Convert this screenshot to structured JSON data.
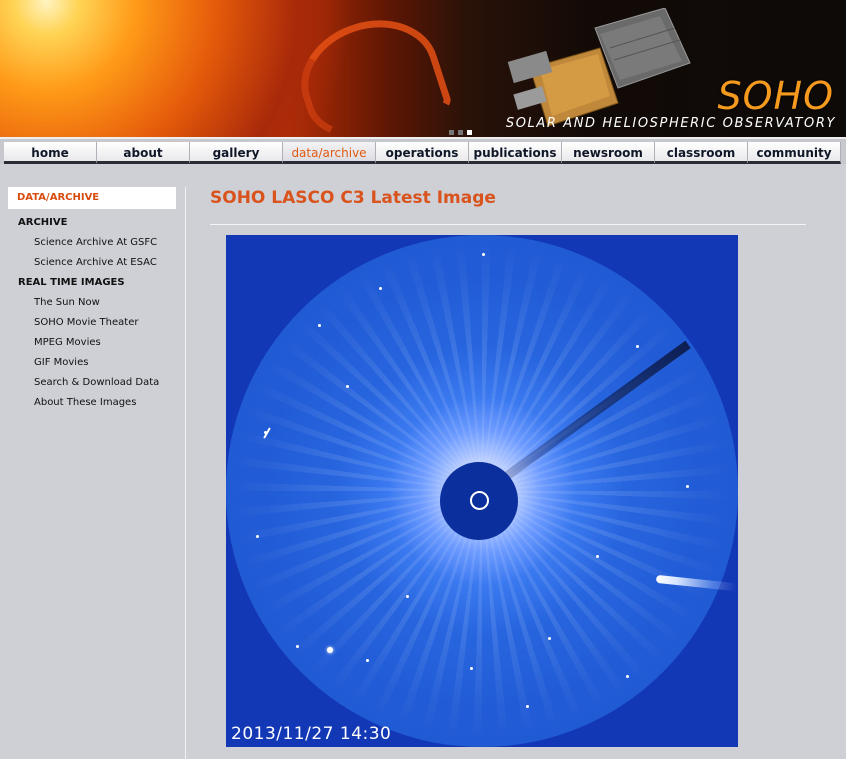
{
  "header": {
    "logo": "SOHO",
    "tagline": "SOLAR AND HELIOSPHERIC OBSERVATORY"
  },
  "nav": {
    "items": [
      {
        "label": "home"
      },
      {
        "label": "about"
      },
      {
        "label": "gallery"
      },
      {
        "label": "data/archive",
        "active": true
      },
      {
        "label": "operations"
      },
      {
        "label": "publications"
      },
      {
        "label": "newsroom"
      },
      {
        "label": "classroom"
      },
      {
        "label": "community"
      }
    ]
  },
  "sidebar": {
    "heading": "DATA/ARCHIVE",
    "sections": [
      {
        "title": "ARCHIVE",
        "items": [
          "Science Archive At GSFC",
          "Science Archive At ESAC"
        ]
      },
      {
        "title": "REAL TIME IMAGES",
        "items": [
          "The Sun Now",
          "SOHO Movie Theater",
          "MPEG Movies",
          "GIF Movies",
          "Search & Download Data",
          "About These Images"
        ]
      }
    ]
  },
  "main": {
    "title": "SOHO LASCO C3 Latest Image",
    "image": {
      "timestamp": "2013/11/27 14:30"
    }
  },
  "colors": {
    "accent": "#d9531c",
    "sky_blue": "#215cd6",
    "background": "#cfd0d6"
  }
}
